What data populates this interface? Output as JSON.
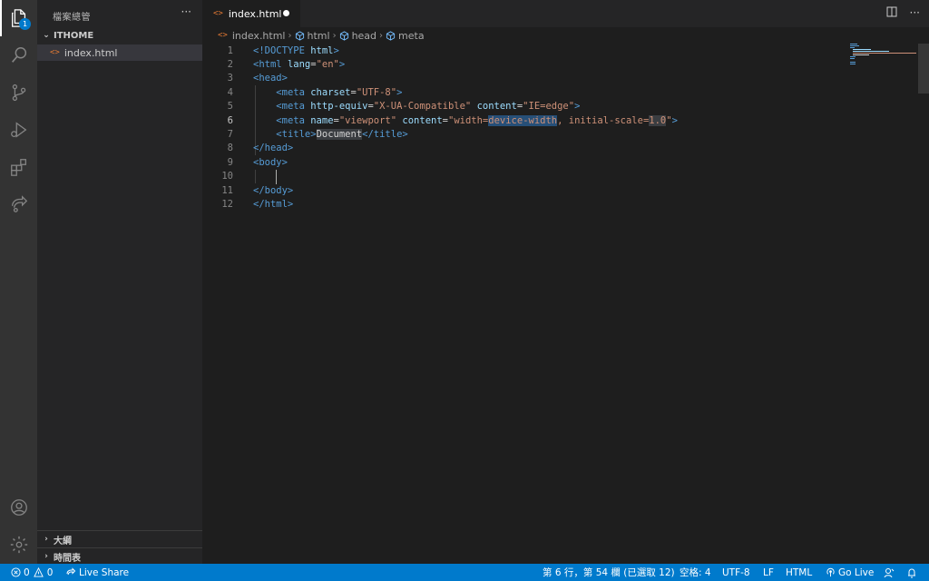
{
  "activity_bar": {
    "explorer_badge": "1",
    "items": [
      "explorer",
      "search",
      "source-control",
      "run-debug",
      "extensions",
      "live-share",
      "accounts",
      "settings"
    ]
  },
  "sidebar": {
    "title": "檔案總管",
    "more_label": "···",
    "workspace": "ITHOME",
    "files": [
      {
        "name": "index.html",
        "icon": "<>"
      }
    ],
    "sections": [
      {
        "label": "大綱"
      },
      {
        "label": "時間表"
      }
    ]
  },
  "editor": {
    "tab": {
      "label": "index.html",
      "icon": "<>"
    },
    "breadcrumb": [
      "index.html",
      "html",
      "head",
      "meta"
    ],
    "line_numbers": [
      "1",
      "2",
      "3",
      "4",
      "5",
      "6",
      "7",
      "8",
      "9",
      "10",
      "11",
      "12"
    ],
    "current_line": "6",
    "lines": [
      [
        {
          "k": "tag",
          "v": "<!DOCTYPE "
        },
        {
          "k": "attr",
          "v": "html"
        },
        {
          "k": "tag",
          "v": ">"
        }
      ],
      [
        {
          "k": "tag",
          "v": "<html "
        },
        {
          "k": "attr",
          "v": "lang"
        },
        {
          "k": "plain",
          "v": "="
        },
        {
          "k": "str",
          "v": "\"en\""
        },
        {
          "k": "tag",
          "v": ">"
        }
      ],
      [
        {
          "k": "tag",
          "v": "<head>"
        }
      ],
      [
        {
          "k": "plain",
          "v": "    "
        },
        {
          "k": "tag",
          "v": "<meta "
        },
        {
          "k": "attr",
          "v": "charset"
        },
        {
          "k": "plain",
          "v": "="
        },
        {
          "k": "str",
          "v": "\"UTF-8\""
        },
        {
          "k": "tag",
          "v": ">"
        }
      ],
      [
        {
          "k": "plain",
          "v": "    "
        },
        {
          "k": "tag",
          "v": "<meta "
        },
        {
          "k": "attr",
          "v": "http-equiv"
        },
        {
          "k": "plain",
          "v": "="
        },
        {
          "k": "str",
          "v": "\"X-UA-Compatible\""
        },
        {
          "k": "plain",
          "v": " "
        },
        {
          "k": "attr",
          "v": "content"
        },
        {
          "k": "plain",
          "v": "="
        },
        {
          "k": "str",
          "v": "\"IE=edge\""
        },
        {
          "k": "tag",
          "v": ">"
        }
      ],
      [
        {
          "k": "plain",
          "v": "    "
        },
        {
          "k": "tag",
          "v": "<meta "
        },
        {
          "k": "attr",
          "v": "name"
        },
        {
          "k": "plain",
          "v": "="
        },
        {
          "k": "str",
          "v": "\"viewport\""
        },
        {
          "k": "plain",
          "v": " "
        },
        {
          "k": "attr",
          "v": "content"
        },
        {
          "k": "plain",
          "v": "="
        },
        {
          "k": "str",
          "v": "\"width="
        },
        {
          "k": "str sel",
          "v": "device-width"
        },
        {
          "k": "str",
          "v": ", initial-scale="
        },
        {
          "k": "str hl",
          "v": "1.0"
        },
        {
          "k": "str",
          "v": "\""
        },
        {
          "k": "tag",
          "v": ">"
        }
      ],
      [
        {
          "k": "plain",
          "v": "    "
        },
        {
          "k": "tag",
          "v": "<title>"
        },
        {
          "k": "plain hl",
          "v": "Document"
        },
        {
          "k": "tag",
          "v": "</title>"
        }
      ],
      [
        {
          "k": "tag",
          "v": "</head>"
        }
      ],
      [
        {
          "k": "tag",
          "v": "<body>"
        }
      ],
      [
        {
          "k": "plain",
          "v": ""
        }
      ],
      [
        {
          "k": "tag",
          "v": "</body>"
        }
      ],
      [
        {
          "k": "tag",
          "v": "</html>"
        }
      ]
    ]
  },
  "statusbar": {
    "errors": "0",
    "warnings": "0",
    "live_share": "Live Share",
    "position": "第 6 行，第 54 欄 (已選取 12)",
    "spaces": "空格: 4",
    "encoding": "UTF-8",
    "eol": "LF",
    "language": "HTML",
    "go_live": "Go Live"
  },
  "colors": {
    "activity_bg": "#333333",
    "sidebar_bg": "#252526",
    "editor_bg": "#1e1e1e",
    "status_bg": "#007acc",
    "html_icon": "#e37933"
  }
}
